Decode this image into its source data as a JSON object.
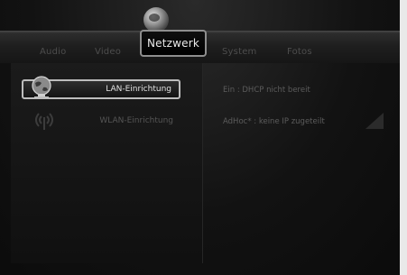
{
  "menu": {
    "tabs": [
      {
        "label": "Audio"
      },
      {
        "label": "Video"
      },
      {
        "label": "Netzwerk"
      },
      {
        "label": "System"
      },
      {
        "label": "Fotos"
      }
    ],
    "active_tab": "Netzwerk"
  },
  "settings_list": {
    "items": [
      {
        "label": "LAN-Einrichtung",
        "icon": "lan-globe-icon",
        "selected": true
      },
      {
        "label": "WLAN-Einrichtung",
        "icon": "wlan-antenna-icon",
        "selected": false
      }
    ]
  },
  "status": {
    "lan": "Ein : DHCP nicht bereit",
    "wlan": "AdHoc* : keine IP zugeteilt"
  },
  "colors": {
    "background": "#111111",
    "active_border": "#8e8e8e",
    "selected_border": "#bdbdbd",
    "inactive_text": "#4d4d4d"
  }
}
